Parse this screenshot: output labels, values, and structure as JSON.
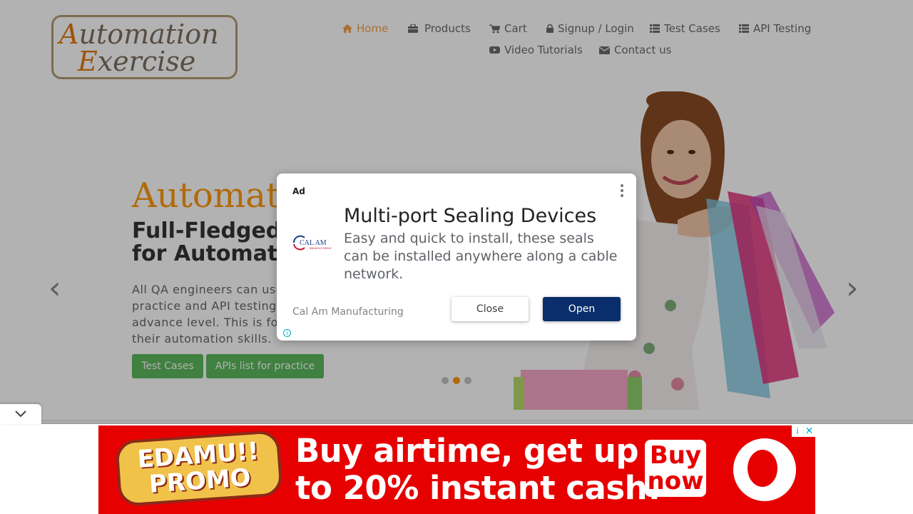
{
  "logo": {
    "line1_cap": "A",
    "line1_rest": "utomation",
    "line2_cap": "E",
    "line2_rest": "xercise"
  },
  "nav": [
    {
      "label": "Home",
      "icon": "home-icon"
    },
    {
      "label": "Products",
      "icon": "briefcase-icon"
    },
    {
      "label": "Cart",
      "icon": "cart-icon"
    },
    {
      "label": "Signup / Login",
      "icon": "lock-icon"
    },
    {
      "label": "Test Cases",
      "icon": "list-icon"
    },
    {
      "label": "API Testing",
      "icon": "list-icon"
    },
    {
      "label": "Video Tutorials",
      "icon": "youtube-icon"
    },
    {
      "label": "Contact us",
      "icon": "envelope-icon"
    }
  ],
  "hero": {
    "title": "Automat",
    "subtitle_line1": "Full-Fledged",
    "subtitle_line2": "for Automatio",
    "desc_lines": [
      "All QA engineers can use",
      "practice and API testing e",
      "advance level. This is for",
      "their automation skills."
    ],
    "btn_test_cases": "Test Cases",
    "btn_apis": "APIs list for practice",
    "prev_arrow": "‹",
    "next_arrow": "›",
    "active_slide": 1
  },
  "modal_ad": {
    "ad_label": "Ad",
    "headline": "Multi-port Sealing Devices",
    "body": "Easy and quick to install, these seals can be installed anywhere along a cable network.",
    "advertiser": "Cal Am Manufacturing",
    "logo_text": "CAL AM",
    "logo_sub": "MANUFACTURING",
    "close_label": "Close",
    "open_label": "Open"
  },
  "banner_ad": {
    "promo_line1": "EDAMU!!",
    "promo_line2": "PROMO",
    "text_line1": "Buy airtime, get up",
    "text_line2": "to 20% instant cash!",
    "buy_line1": "Buy",
    "buy_line2": "now",
    "adchoices_icon": "i",
    "close_icon": "✕"
  },
  "colors": {
    "accent": "#fe980f",
    "green_button": "#5cb85c",
    "banner_red": "#e60000",
    "open_button": "#0a2e6b"
  }
}
